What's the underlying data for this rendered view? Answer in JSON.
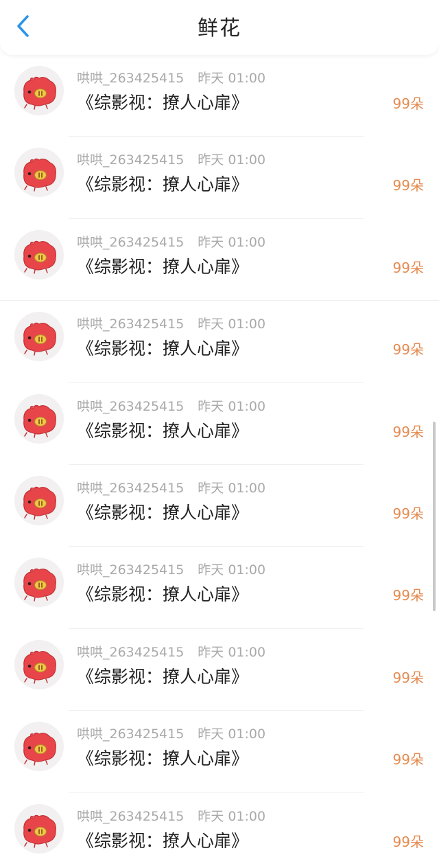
{
  "header": {
    "title": "鲜花",
    "back_icon": "chevron-left-icon",
    "accent_color": "#2b93ea"
  },
  "items": [
    {
      "user": "哄哄_263425415",
      "time": "昨天 01:00",
      "book": "《综影视：撩人心扉》",
      "count": "99朵"
    },
    {
      "user": "哄哄_263425415",
      "time": "昨天 01:00",
      "book": "《综影视：撩人心扉》",
      "count": "99朵"
    },
    {
      "user": "哄哄_263425415",
      "time": "昨天 01:00",
      "book": "《综影视：撩人心扉》",
      "count": "99朵"
    },
    {
      "user": "哄哄_263425415",
      "time": "昨天 01:00",
      "book": "《综影视：撩人心扉》",
      "count": "99朵"
    },
    {
      "user": "哄哄_263425415",
      "time": "昨天 01:00",
      "book": "《综影视：撩人心扉》",
      "count": "99朵"
    },
    {
      "user": "哄哄_263425415",
      "time": "昨天 01:00",
      "book": "《综影视：撩人心扉》",
      "count": "99朵"
    },
    {
      "user": "哄哄_263425415",
      "time": "昨天 01:00",
      "book": "《综影视：撩人心扉》",
      "count": "99朵"
    },
    {
      "user": "哄哄_263425415",
      "time": "昨天 01:00",
      "book": "《综影视：撩人心扉》",
      "count": "99朵"
    },
    {
      "user": "哄哄_263425415",
      "time": "昨天 01:00",
      "book": "《综影视：撩人心扉》",
      "count": "99朵"
    },
    {
      "user": "哄哄_263425415",
      "time": "昨天 01:00",
      "book": "《综影视：撩人心扉》",
      "count": "99朵"
    }
  ],
  "avatar_icon": "pig-avatar-icon",
  "colors": {
    "count": "#e58a4e",
    "meta": "#a9a9a9",
    "avatar_pig": "#e8454a"
  }
}
